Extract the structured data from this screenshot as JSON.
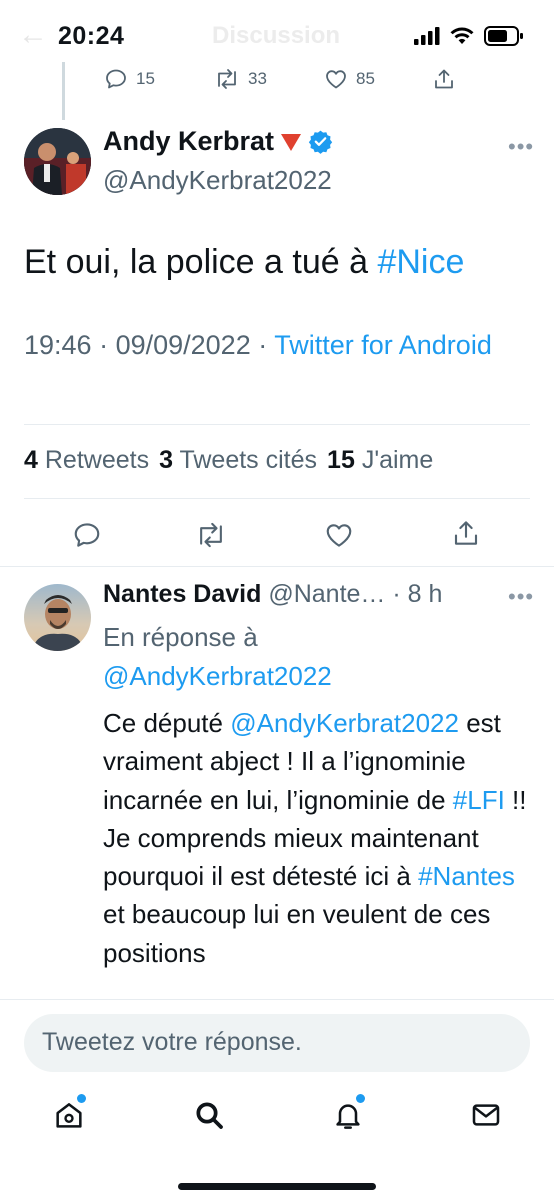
{
  "status": {
    "time": "20:24"
  },
  "header": {
    "back": "←",
    "title": "Discussion"
  },
  "prev_tweet": {
    "replies": "15",
    "retweets": "33",
    "likes": "85"
  },
  "tweet": {
    "name": "Andy Kerbrat",
    "handle": "@AndyKerbrat2022",
    "text_before": "Et oui, la police a tué à ",
    "text_hashtag": "#Nice",
    "time": "19:46",
    "date": "09/09/2022",
    "source": "Twitter for Android",
    "retweets_count": "4",
    "retweets_label": "Retweets",
    "quotes_count": "3",
    "quotes_label": "Tweets cités",
    "likes_count": "15",
    "likes_label": "J'aime"
  },
  "reply": {
    "name": "Nantes David",
    "handle": "@Nante…",
    "age": "8 h",
    "in_reply_label": "En réponse à",
    "in_reply_handle": "@AndyKerbrat2022",
    "t1": "Ce député ",
    "m1": "@AndyKerbrat2022",
    "t2": " est vraiment abject ! Il a l’ignominie incarnée en lui, l’ignominie de ",
    "h1": "#LFI",
    "t3": " !! Je comprends mieux maintenant pourquoi il est détesté ici à ",
    "h2": "#Nantes",
    "t4": " et beaucoup lui en veulent de ces positions"
  },
  "compose": {
    "placeholder": "Tweetez votre réponse."
  },
  "colors": {
    "accent": "#1d9bf0",
    "muted": "#536471",
    "text": "#0f1419"
  }
}
